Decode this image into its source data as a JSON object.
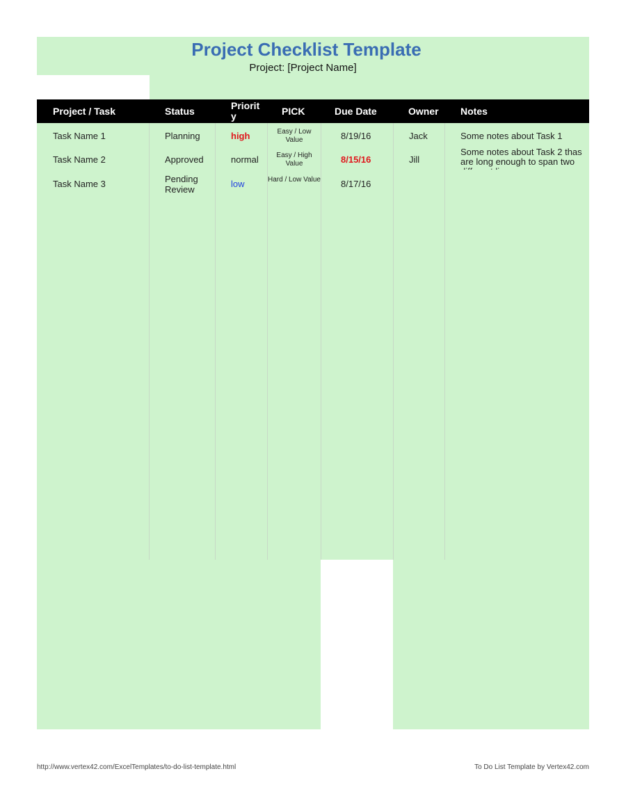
{
  "title": "Project Checklist Template",
  "subtitle": "Project: [Project Name]",
  "columns": [
    "Project / Task",
    "Status",
    "Priorit\ny",
    "PICK",
    "Due Date",
    "Owner",
    "Notes"
  ],
  "rows": [
    {
      "task": "Task Name 1",
      "status": "Planning",
      "priority": "high",
      "pick": "Easy / Low Value",
      "due": "8/19/16",
      "owner": "Jack",
      "notes": "Some notes about Task 1"
    },
    {
      "task": "Task Name 2",
      "status": "Approved",
      "priority": "normal",
      "pick": "Easy / High Value",
      "due": "8/15/16",
      "owner": "Jill",
      "notes": "Some notes about Task 2 thas are long enough to span two different lines"
    },
    {
      "task": "Task Name 3",
      "status": "Pending Review",
      "priority": "low",
      "pick": "Hard / Low Value",
      "due": "8/17/16",
      "owner": "",
      "notes": ""
    }
  ],
  "colors": {
    "band": "#cef3cd",
    "title": "#3a6db3",
    "high": "#e0161c",
    "low": "#1f3fe0",
    "overdue": "#e0161c"
  },
  "footer": {
    "left": "http://www.vertex42.com/ExcelTemplates/to-do-list-template.html",
    "right": "To Do List Template by Vertex42.com"
  }
}
